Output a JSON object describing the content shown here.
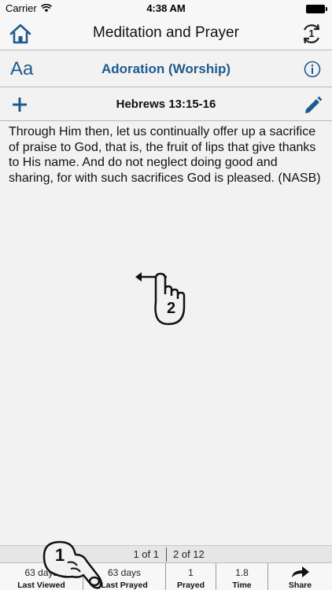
{
  "status_bar": {
    "carrier": "Carrier",
    "time": "4:38 AM"
  },
  "nav": {
    "title": "Meditation and Prayer",
    "sync_badge": "1"
  },
  "topic": {
    "font_icon_label": "Aa",
    "title": "Adoration (Worship)"
  },
  "reference": {
    "title": "Hebrews 13:15-16"
  },
  "passage": {
    "text": "Through Him then, let us continually offer up a sacrifice of praise to God, that is, the fruit of lips that give thanks to His name. And do not neglect doing good and sharing, for with such sacrifices God is pleased. (NASB)"
  },
  "gestures": {
    "swipe_number": "2",
    "tap_number": "1"
  },
  "pager": {
    "left": "1 of 1",
    "right": "2 of 12"
  },
  "tabs": [
    {
      "value": "63 days",
      "label": "Last Viewed"
    },
    {
      "value": "63 days",
      "label": "Last Prayed"
    },
    {
      "value": "1",
      "label": "Prayed"
    },
    {
      "value": "1.8",
      "label": "Time"
    },
    {
      "value": "",
      "label": "Share"
    }
  ],
  "colors": {
    "accent": "#1f5a8e",
    "background": "#f2f2f2"
  },
  "icons": [
    "home-icon",
    "sync-icon",
    "font-size-icon",
    "info-icon",
    "plus-icon",
    "pencil-icon",
    "share-arrow-icon",
    "swipe-gesture-icon",
    "tap-gesture-icon",
    "wifi-icon",
    "battery-icon"
  ]
}
